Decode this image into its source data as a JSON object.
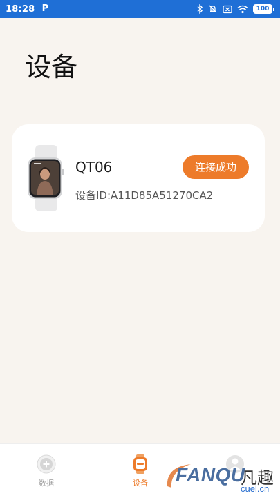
{
  "status_bar": {
    "time": "18:28",
    "app_badge": "P",
    "battery": "100"
  },
  "page": {
    "title": "设备"
  },
  "device": {
    "name": "QT06",
    "id_text": "设备ID:A11D85A51270CA2",
    "status_button": "连接成功"
  },
  "nav": {
    "items": [
      {
        "label": "数据",
        "icon": "health-plus-icon",
        "active": false
      },
      {
        "label": "设备",
        "icon": "watch-icon",
        "active": true
      },
      {
        "label": "",
        "icon": "profile-icon",
        "active": false
      }
    ]
  },
  "watermark": {
    "brand": "FANQU",
    "cn": "凡趣",
    "site": "cuel.cn"
  },
  "colors": {
    "accent": "#ed7b2a",
    "status_bar": "#1f6fd6",
    "background": "#f8f4ef"
  }
}
